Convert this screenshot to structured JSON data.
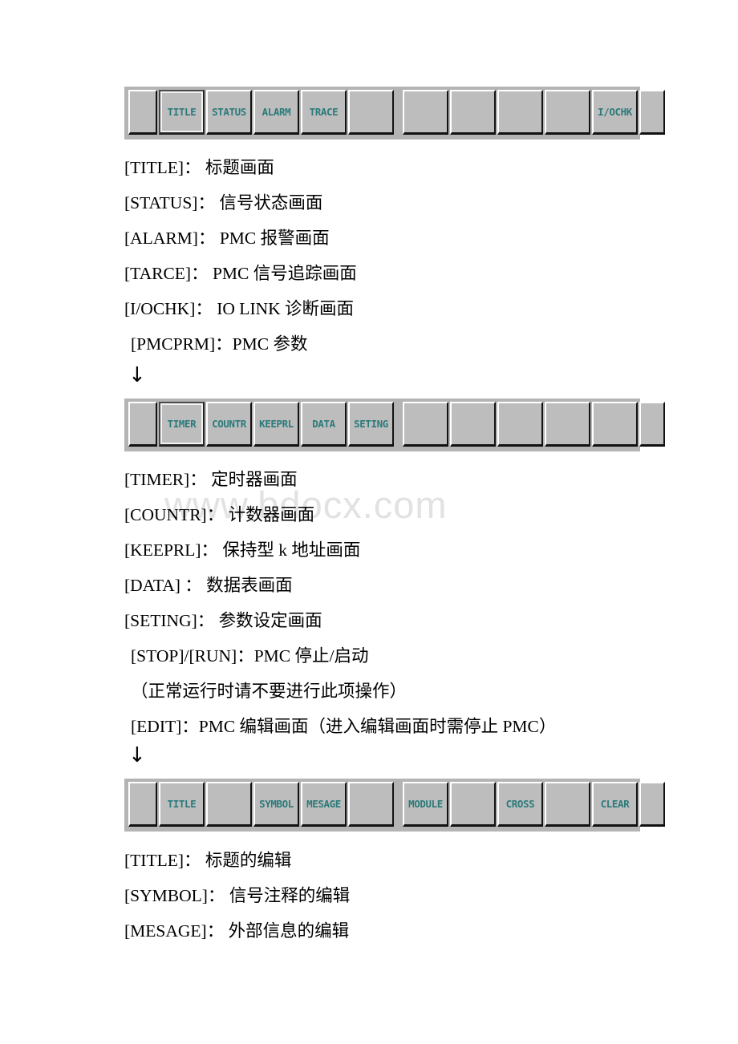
{
  "watermark": "www.bdocx.com",
  "arrows": {
    "glyph": "↓"
  },
  "softkey_bars": [
    {
      "name": "pmc-main-softkey-bar",
      "left_group": [
        {
          "label": "",
          "type": "stub",
          "selected": false
        },
        {
          "label": "TITLE",
          "type": "cell",
          "selected": true
        },
        {
          "label": "STATUS",
          "type": "cell",
          "selected": false
        },
        {
          "label": "ALARM",
          "type": "cell",
          "selected": false
        },
        {
          "label": "TRACE",
          "type": "cell",
          "selected": false
        },
        {
          "label": "",
          "type": "cell",
          "selected": false
        }
      ],
      "right_group": [
        {
          "label": "",
          "type": "cell",
          "selected": false
        },
        {
          "label": "",
          "type": "cell",
          "selected": false
        },
        {
          "label": "",
          "type": "cell",
          "selected": false
        },
        {
          "label": "",
          "type": "cell",
          "selected": false
        },
        {
          "label": "I/OCHK",
          "type": "cell",
          "selected": false
        },
        {
          "label": "",
          "type": "stub-r",
          "selected": false
        }
      ]
    },
    {
      "name": "pmcprm-softkey-bar",
      "left_group": [
        {
          "label": "",
          "type": "stub",
          "selected": false
        },
        {
          "label": "TIMER",
          "type": "cell",
          "selected": true
        },
        {
          "label": "COUNTR",
          "type": "cell",
          "selected": false
        },
        {
          "label": "KEEPRL",
          "type": "cell",
          "selected": false
        },
        {
          "label": "DATA",
          "type": "cell",
          "selected": false
        },
        {
          "label": "SETING",
          "type": "cell",
          "selected": false
        }
      ],
      "right_group": [
        {
          "label": "",
          "type": "cell",
          "selected": false
        },
        {
          "label": "",
          "type": "cell",
          "selected": false
        },
        {
          "label": "",
          "type": "cell",
          "selected": false
        },
        {
          "label": "",
          "type": "cell",
          "selected": false
        },
        {
          "label": "",
          "type": "cell",
          "selected": false
        },
        {
          "label": "",
          "type": "stub-r",
          "selected": false
        }
      ]
    },
    {
      "name": "pmc-edit-softkey-bar",
      "left_group": [
        {
          "label": "",
          "type": "stub",
          "selected": false
        },
        {
          "label": "TITLE",
          "type": "cell",
          "selected": false
        },
        {
          "label": "",
          "type": "cell",
          "selected": false
        },
        {
          "label": "SYMBOL",
          "type": "cell",
          "selected": false
        },
        {
          "label": "MESAGE",
          "type": "cell",
          "selected": false
        },
        {
          "label": "",
          "type": "cell",
          "selected": false
        }
      ],
      "right_group": [
        {
          "label": "MODULE",
          "type": "cell",
          "selected": false
        },
        {
          "label": "",
          "type": "cell",
          "selected": false
        },
        {
          "label": "CROSS",
          "type": "cell",
          "selected": false
        },
        {
          "label": "",
          "type": "cell",
          "selected": false
        },
        {
          "label": "CLEAR",
          "type": "cell",
          "selected": false
        },
        {
          "label": "",
          "type": "stub-r",
          "selected": false
        }
      ]
    }
  ],
  "section1_lines": [
    "[TITLE]：  标题画面",
    "[STATUS]：  信号状态画面",
    "[ALARM]：  PMC 报警画面",
    "[TARCE]：  PMC 信号追踪画面",
    "[I/OCHK]：  IO LINK 诊断画面",
    "[PMCPRM]：PMC 参数"
  ],
  "section2_lines": [
    "[TIMER]：  定时器画面",
    "[COUNTR]：  计数器画面",
    "[KEEPRL]：  保持型 k 地址画面",
    "[DATA] ：  数据表画面",
    "[SETING]：  参数设定画面",
    "[STOP]/[RUN]：PMC 停止/启动",
    "（正常运行时请不要进行此项操作）",
    "[EDIT]：PMC 编辑画面（进入编辑画面时需停止 PMC）"
  ],
  "section3_lines": [
    "[TITLE]：  标题的编辑",
    "[SYMBOL]：  信号注释的编辑",
    "[MESAGE]：  外部信息的编辑"
  ],
  "colors": {
    "softkey_label": "#2c7a7a",
    "softkey_face": "#bdbdbd",
    "softbar_back": "#b4b4b4",
    "watermark": "#e2e2e2"
  }
}
